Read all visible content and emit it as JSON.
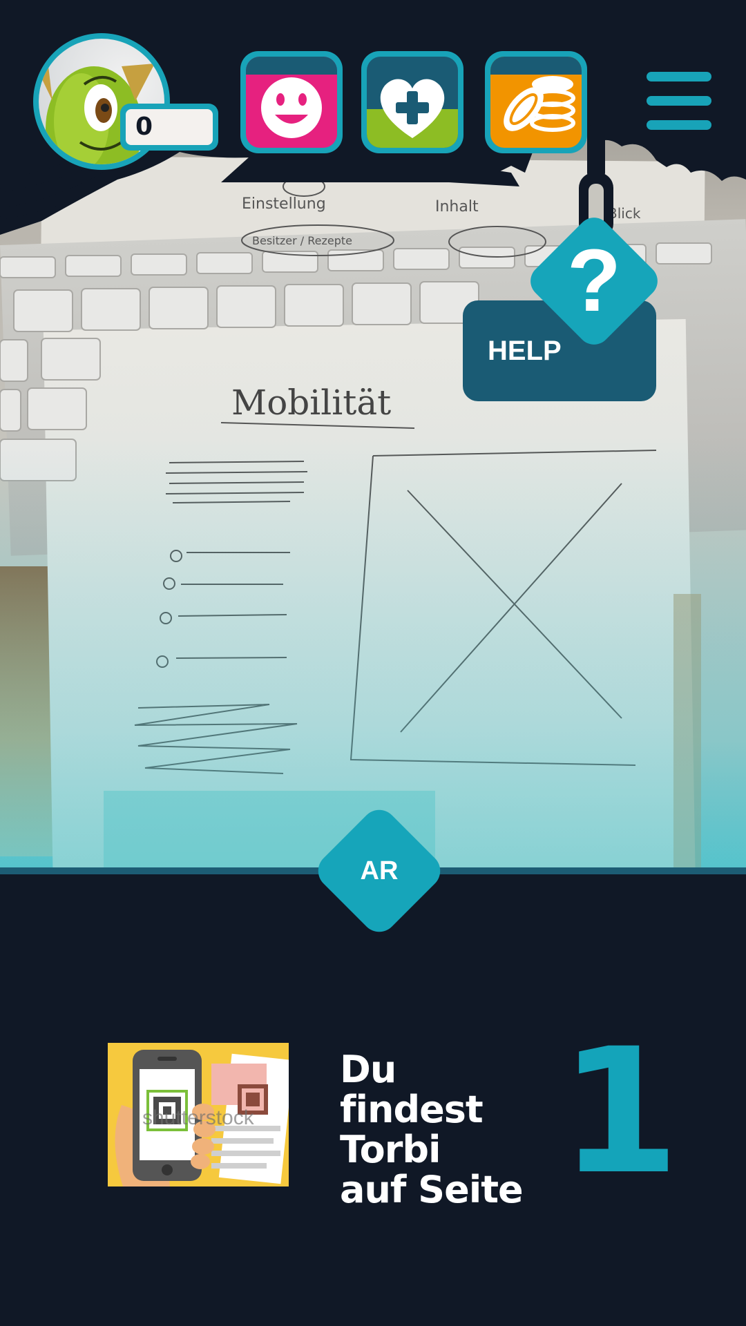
{
  "header": {
    "score": "0",
    "buttons": [
      {
        "id": "mood",
        "icon": "smiley-icon",
        "color": "#e6217f"
      },
      {
        "id": "health",
        "icon": "heart-plus-icon",
        "color": "#8dbd24"
      },
      {
        "id": "coins",
        "icon": "coins-icon",
        "color": "#f29400"
      }
    ],
    "menu_icon": "hamburger-menu-icon"
  },
  "help": {
    "label": "HELP",
    "symbol": "?"
  },
  "ar": {
    "label": "AR"
  },
  "hint": {
    "line1": "Du findest",
    "line2": "Torbi",
    "line3": "auf Seite",
    "page_number": "1",
    "image_watermark": "shutterstock"
  },
  "camera_sketch": {
    "top_labels": [
      "Einstellung",
      "Inhalt",
      "Blick",
      "Besitzer / Rezepte"
    ],
    "title": "Mobilität"
  },
  "colors": {
    "background": "#101826",
    "accent": "#16a5ba",
    "help_box": "#1a5b74"
  }
}
